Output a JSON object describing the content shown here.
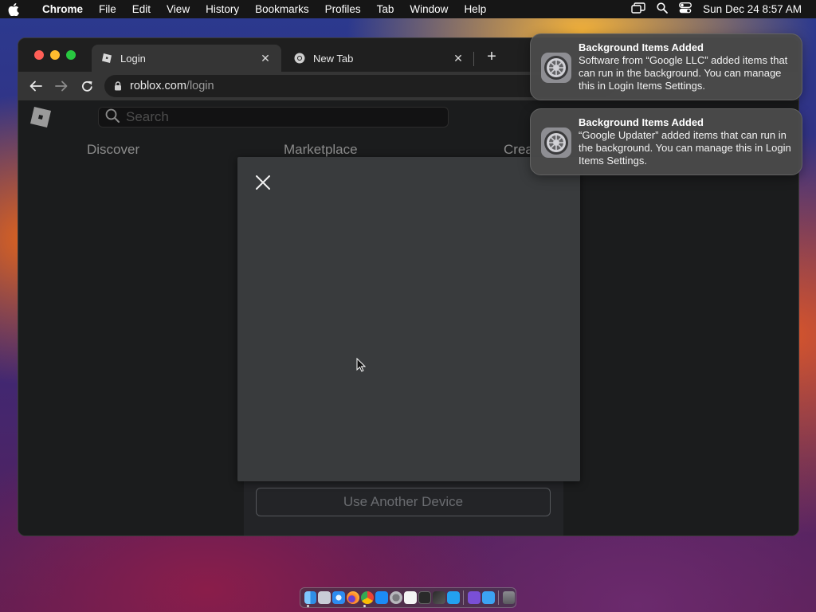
{
  "menubar": {
    "app_name": "Chrome",
    "items": [
      "File",
      "Edit",
      "View",
      "History",
      "Bookmarks",
      "Profiles",
      "Tab",
      "Window",
      "Help"
    ],
    "clock": "Sun Dec 24  8:57 AM"
  },
  "browser": {
    "tabs": [
      {
        "title": "Login",
        "active": true
      },
      {
        "title": "New Tab",
        "active": false
      }
    ],
    "new_tab_label": "+",
    "url_host": "roblox.com",
    "url_path": "/login"
  },
  "site": {
    "search_placeholder": "Search",
    "nav": [
      "Discover",
      "Marketplace",
      "Create"
    ],
    "another_device_label": "Use Another Device"
  },
  "notifications": [
    {
      "title": "Background Items Added",
      "body": "Software from “Google LLC” added items that can run in the background. You can manage this in Login Items Settings."
    },
    {
      "title": "Background Items Added",
      "body": "“Google Updater” added items that can run in the background. You can manage this in Login Items Settings."
    }
  ],
  "colors": {
    "traffic_close": "#ff5f57",
    "traffic_min": "#febc2e",
    "traffic_max": "#28c840",
    "modal_bg": "#393b3d",
    "page_bg": "#1b1c1d"
  },
  "dock": {
    "icons": [
      "finder-icon",
      "launchpad-icon",
      "safari-icon",
      "firefox-icon",
      "chrome-icon",
      "app-store-icon",
      "system-settings-icon",
      "textedit-icon",
      "terminal-icon",
      "xcode-icon",
      "vscode-icon",
      "visual-studio-icon",
      "finder-folder-icon",
      "trash-icon"
    ]
  }
}
